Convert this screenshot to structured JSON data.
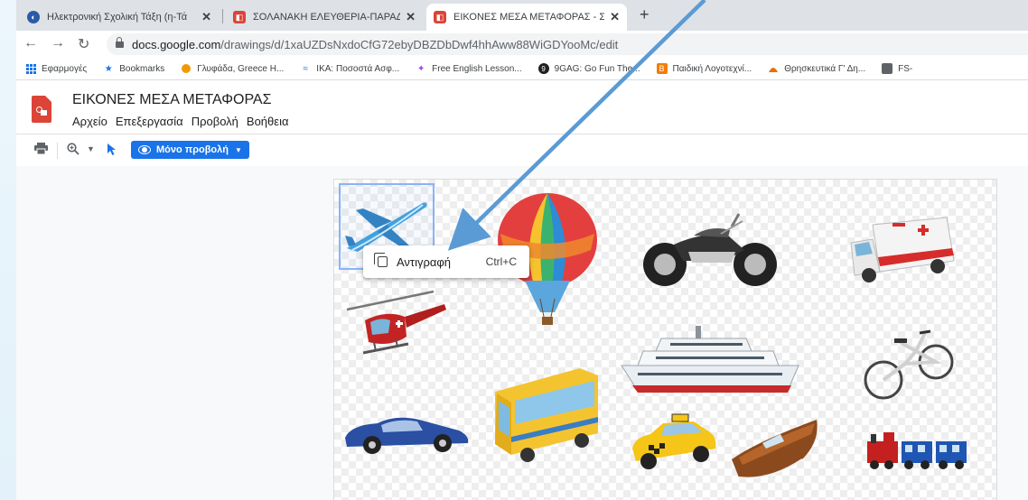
{
  "tabs": [
    {
      "title": "Ηλεκτρονική Σχολική Τάξη (η-Τά",
      "favicon": "globe-icon",
      "color": "#2b5ba8"
    },
    {
      "title": "ΣΟΛΑΝΑΚΗ ΕΛΕΥΘΕΡΙΑ-ΠΑΡΑΔΕ",
      "favicon": "drawings-icon",
      "color": "#db4437"
    },
    {
      "title": "ΕΙΚΟΝΕΣ ΜΕΣΑ ΜΕΤΑΦΟΡΑΣ - Σ",
      "favicon": "drawings-icon",
      "color": "#db4437",
      "active": true
    }
  ],
  "address": {
    "host": "docs.google.com",
    "path": "/drawings/d/1xaUZDsNxdoCfG72ebyDBZDbDwf4hhAww88WiGDYooMc/edit"
  },
  "bookmarks": [
    {
      "label": "Εφαρμογές",
      "icon": "apps-grid-icon",
      "color": "#1a73e8"
    },
    {
      "label": "Bookmarks",
      "icon": "star-icon",
      "color": "#1a73e8"
    },
    {
      "label": "Γλυφάδα, Greece H...",
      "icon": "weather-icon",
      "color": "#f29900"
    },
    {
      "label": "ΙΚΑ: Ποσοστά Ασφ...",
      "icon": "ika-icon",
      "color": "#1a73e8"
    },
    {
      "label": "Free English Lesson...",
      "icon": "lesson-icon",
      "color": "#a142f4"
    },
    {
      "label": "9GAG: Go Fun The...",
      "icon": "9gag-icon",
      "color": "#202124"
    },
    {
      "label": "Παιδική Λογοτεχνί...",
      "icon": "blogger-icon",
      "color": "#f57c00"
    },
    {
      "label": "Θρησκευτικά Γ' Δη...",
      "icon": "shell-icon",
      "color": "#e8710a"
    },
    {
      "label": "FS-",
      "icon": "fs-icon",
      "color": "#5f6368"
    }
  ],
  "doc": {
    "title": "ΕΙΚΟΝΕΣ ΜΕΣΑ ΜΕΤΑΦΟΡΑΣ",
    "menu": [
      "Αρχείο",
      "Επεξεργασία",
      "Προβολή",
      "Βοήθεια"
    ]
  },
  "toolbar": {
    "view_mode": "Μόνο προβολή"
  },
  "context_menu": {
    "label": "Αντιγραφή",
    "shortcut": "Ctrl+C"
  },
  "canvas_items": [
    "airplane",
    "hot-air-balloon",
    "motorcycle",
    "ambulance",
    "helicopter",
    "cruise-ship",
    "bicycle",
    "car",
    "bus",
    "taxi",
    "speedboat",
    "train"
  ],
  "colors": {
    "accent": "#1a73e8",
    "arrow": "#5b9bd5",
    "drawings": "#db4437"
  }
}
